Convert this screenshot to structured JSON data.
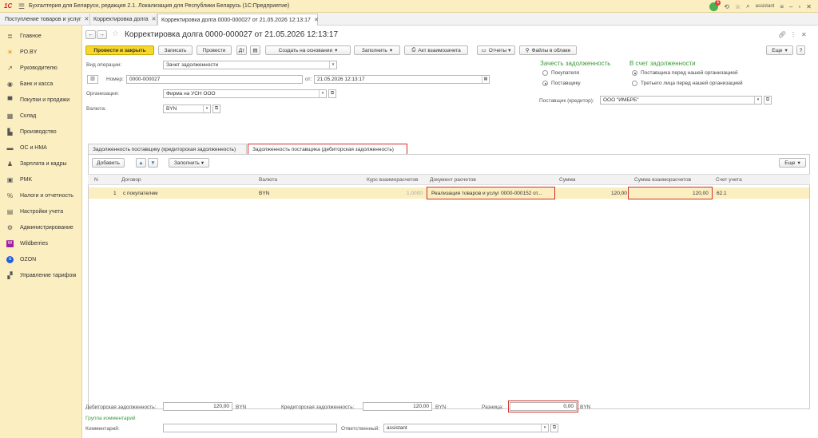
{
  "app": {
    "title": "Бухгалтерия для Беларуси, редакция 2.1. Локализация для Республики Беларусь (1С:Предприятие)",
    "user": "assistant",
    "notifications": "1"
  },
  "tabs": [
    {
      "label": "Поступление товаров и услуг"
    },
    {
      "label": "Корректировка долга"
    },
    {
      "label": "Корректировка долга 0000-000027 от 21.05.2026 12:13:17"
    }
  ],
  "sidebar": {
    "items": [
      {
        "label": "Главное",
        "icon": "menu-icon"
      },
      {
        "label": "PO.BY",
        "icon": "sun-icon"
      },
      {
        "label": "Руководителю",
        "icon": "chart-icon"
      },
      {
        "label": "Банк и касса",
        "icon": "bank-icon"
      },
      {
        "label": "Покупки и продажи",
        "icon": "cart-icon"
      },
      {
        "label": "Склад",
        "icon": "warehouse-icon"
      },
      {
        "label": "Производство",
        "icon": "factory-icon"
      },
      {
        "label": "ОС и НМА",
        "icon": "truck-icon"
      },
      {
        "label": "Зарплата и кадры",
        "icon": "people-icon"
      },
      {
        "label": "PMK",
        "icon": "printer-icon"
      },
      {
        "label": "Налоги и отчетность",
        "icon": "percent-icon"
      },
      {
        "label": "Настройки учета",
        "icon": "ledger-icon"
      },
      {
        "label": "Администрирование",
        "icon": "gear-icon"
      },
      {
        "label": "Wildberries",
        "icon": "wildberries-icon"
      },
      {
        "label": "OZON",
        "icon": "ozon-icon"
      },
      {
        "label": "Управление тарифом",
        "icon": "tariff-icon"
      }
    ]
  },
  "doc": {
    "title": "Корректировка долга 0000-000027 от 21.05.2026 12:13:17"
  },
  "toolbar": {
    "post_close": "Провести и закрыть",
    "save": "Записать",
    "post": "Провести",
    "create_based": "Создать на основании",
    "fill": "Заполнить",
    "act": "Акт взаимозачета",
    "reports": "Отчеты",
    "files": "Файлы в облаке",
    "more": "Еще"
  },
  "form": {
    "operation_label": "Вид операции:",
    "operation_value": "Зачет задолженности",
    "number_label": "Номер:",
    "number_value": "0000-000027",
    "date_label": "от:",
    "date_value": "21.05.2026 12:13:17",
    "org_label": "Организация:",
    "org_value": "Фирма на УСН ООО",
    "currency_label": "Валюта:",
    "currency_value": "BYN",
    "offset_title": "Зачесть задолженность",
    "offset_opt1": "Покупателя",
    "offset_opt2": "Поставщику",
    "against_title": "В счет задолженности",
    "against_opt1": "Поставщика перед нашей организацией",
    "against_opt2": "Третьего лица перед нашей организацией",
    "supplier_label": "Поставщик (кредитор):",
    "supplier_value": "ООО \"ИМБРБ\""
  },
  "formtabs": [
    {
      "label": "Задолженность поставщику (кредиторская задолженность)"
    },
    {
      "label": "Задолженность поставщика (дебиторская задолженность)"
    }
  ],
  "table": {
    "add": "Добавить",
    "fill": "Заполнить",
    "more": "Еще",
    "headers": [
      "N",
      "Договор",
      "Валюта",
      "Курс взаиморасчетов",
      "Документ расчетов",
      "Сумма",
      "Сумма взаиморасчетов",
      "Счет учета"
    ],
    "row": {
      "n": "1",
      "contract": "с покупателем",
      "currency": "BYN",
      "rate": "1,0000",
      "document": "Реализация товаров и услуг 0000-000152 от...",
      "sum": "120,00",
      "mutual_sum": "120,00",
      "account": "62.1"
    }
  },
  "footer": {
    "debit_label": "Дебиторская задолженность:",
    "debit_value": "120,00",
    "debit_cur": "BYN",
    "credit_label": "Кредиторская задолженность:",
    "credit_value": "120,00",
    "credit_cur": "BYN",
    "diff_label": "Разница:",
    "diff_value": "0,00",
    "diff_cur": "BYN",
    "comments_group": "Группа комментарий",
    "comment_label": "Комментарий:",
    "comment_value": "",
    "responsible_label": "Ответственный:",
    "responsible_value": "assistant"
  },
  "colors": {
    "accent_yellow": "#f6d72b",
    "sidebar_bg": "#fbeec0",
    "highlight_red": "#d32f2f",
    "green": "#3a9b3a"
  }
}
